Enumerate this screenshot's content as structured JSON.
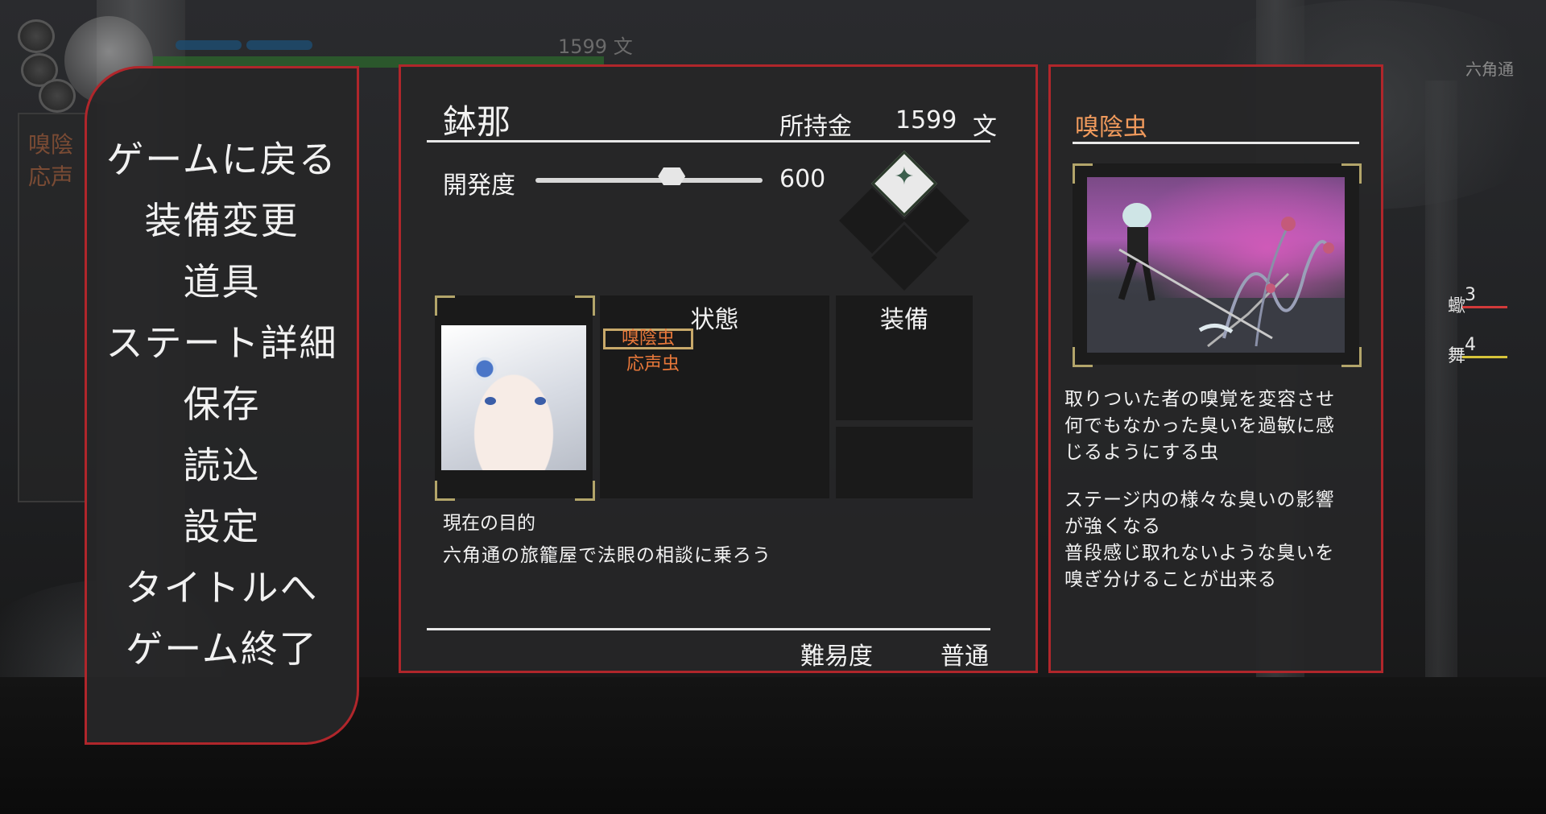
{
  "hud": {
    "money": "1599 文",
    "area": "六角通",
    "left_status": [
      "嗅陰",
      "応声"
    ],
    "stats": [
      {
        "label": "蠍",
        "value": "3",
        "color": "#d23a3a"
      },
      {
        "label": "舞",
        "value": "4",
        "color": "#d6c43a"
      }
    ]
  },
  "menu": {
    "items": [
      "ゲームに戻る",
      "装備変更",
      "道具",
      "ステート詳細",
      "保存",
      "読込",
      "設定",
      "タイトルへ",
      "ゲーム終了"
    ]
  },
  "status": {
    "name": "鉢那",
    "money_label": "所持金",
    "money_value": "1599",
    "money_unit": "文",
    "dev_label": "開発度",
    "dev_value": "600",
    "dev_fraction": 0.6,
    "state_header": "状態",
    "equip_header": "装備",
    "states": [
      "嗅陰虫",
      "応声虫"
    ],
    "goal_label": "現在の目的",
    "goal_text": "六角通の旅籠屋で法眼の相談に乗ろう",
    "difficulty_label": "難易度",
    "difficulty_value": "普通"
  },
  "detail": {
    "title": "嗅陰虫",
    "lines1": [
      "取りついた者の嗅覚を変容させ",
      "何でもなかった臭いを過敏に感",
      "じるようにする虫"
    ],
    "lines2": [
      "ステージ内の様々な臭いの影響",
      "が強くなる",
      "普段感じ取れないような臭いを",
      "嗅ぎ分けることが出来る"
    ]
  },
  "colors": {
    "frame_red": "#b0262b",
    "accent_orange": "#f09a5c",
    "state_orange": "#e8783a",
    "corner_gold": "#b3a56a"
  }
}
